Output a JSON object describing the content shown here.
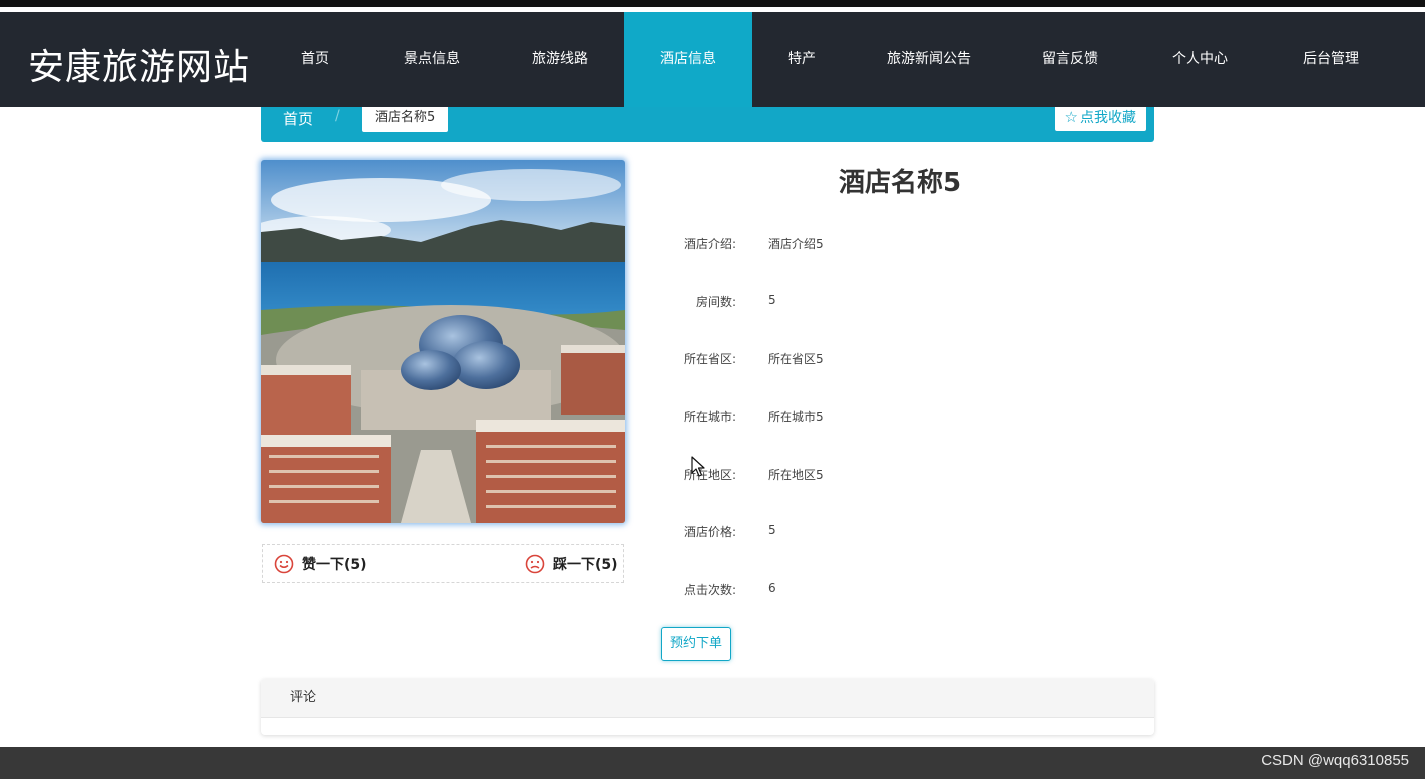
{
  "site": {
    "title": "安康旅游网站"
  },
  "nav": {
    "items": [
      {
        "label": "首页"
      },
      {
        "label": "景点信息"
      },
      {
        "label": "旅游线路"
      },
      {
        "label": "酒店信息"
      },
      {
        "label": "特产"
      },
      {
        "label": "旅游新闻公告"
      },
      {
        "label": "留言反馈"
      },
      {
        "label": "个人中心"
      },
      {
        "label": "后台管理"
      }
    ],
    "active": "酒店信息"
  },
  "breadcrumb": {
    "home": "首页",
    "separator": "/",
    "current": "酒店名称5"
  },
  "favorite": {
    "label": "点我收藏",
    "icon": "star-outline-icon"
  },
  "hotel": {
    "name": "酒店名称5",
    "fields": [
      {
        "label": "酒店介绍:",
        "value": "酒店介绍5"
      },
      {
        "label": "房间数:",
        "value": "5"
      },
      {
        "label": "所在省区:",
        "value": "所在省区5"
      },
      {
        "label": "所在城市:",
        "value": "所在城市5"
      },
      {
        "label": "所在地区:",
        "value": "所在地区5"
      },
      {
        "label": "酒店价格:",
        "value": "5"
      },
      {
        "label": "点击次数:",
        "value": "6"
      }
    ]
  },
  "votes": {
    "like": {
      "label": "赞一下(5)",
      "icon": "smile-icon"
    },
    "dislike": {
      "label": "踩一下(5)",
      "icon": "frown-icon"
    }
  },
  "order": {
    "label": "预约下单"
  },
  "comments": {
    "title": "评论"
  },
  "footer": {
    "watermark": "CSDN @wqq6310855"
  },
  "colors": {
    "accent": "#12a7c7",
    "header": "#232830",
    "footer": "#383838",
    "icon_red": "#d9453b"
  }
}
